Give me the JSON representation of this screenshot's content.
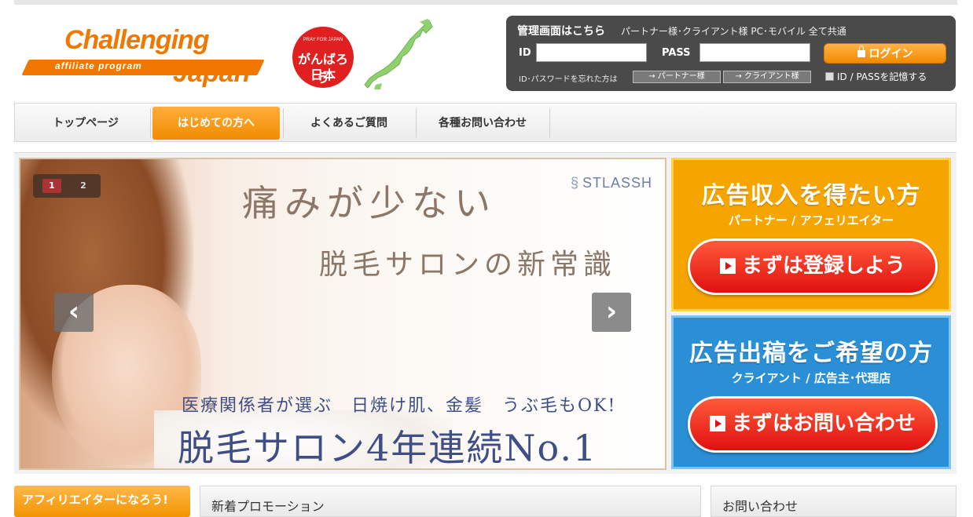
{
  "brand": {
    "logo_line1": "Challenging",
    "logo_tag": "affiliate program",
    "logo_line2": "Japan",
    "emblem_small": "PRAY FOR JAPAN",
    "emblem_main": "がんばろう",
    "emblem_sub": "日本"
  },
  "login": {
    "title": "管理画面はこちら",
    "note": "パートナー様･クライアント様 PC･モバイル 全て共通",
    "id_label": "ID",
    "pass_label": "PASS",
    "id_value": "",
    "pass_value": "",
    "button_label": "ログイン",
    "forgot_text": "ID･パスワードを忘れた方は",
    "forgot_partner": "→ パートナー様",
    "forgot_client": "→ クライアント様",
    "remember_label": "ID / PASSを記憶する"
  },
  "nav": {
    "items": [
      {
        "label": "トップページ"
      },
      {
        "label": "はじめての方へ"
      },
      {
        "label": "よくあるご質問"
      },
      {
        "label": "各種お問い合わせ"
      }
    ]
  },
  "slider": {
    "pages": [
      "1",
      "2"
    ],
    "active_page": "1",
    "brand": "STLASSH",
    "headline1": "痛みが少ない",
    "headline2": "脱毛サロンの新常識",
    "headline3": "医療関係者が選ぶ　日焼け肌、金髪　うぶ毛もOK!",
    "headline4": "脱毛サロン4年連続No.1",
    "prev_icon": "‹",
    "next_icon": "›"
  },
  "promo": {
    "partner": {
      "title": "広告収入を得たい方",
      "sub": "パートナー / アフェリエイター",
      "button": "まずは登録しよう"
    },
    "client": {
      "title": "広告出稿をご希望の方",
      "sub": "クライアント / 広告主･代理店",
      "button": "まずはお問い合わせ"
    }
  },
  "bottom": {
    "affiliate_banner": "アフィリエイターになろう!",
    "new_promotions": "新着プロモーション",
    "contact": "お問い合わせ"
  },
  "colors": {
    "accent_orange": "#f07800",
    "login_bg": "#4a4a4a",
    "promo_partner": "#f5a400",
    "promo_client": "#2b8fd6",
    "cta_red": "#e01010"
  }
}
